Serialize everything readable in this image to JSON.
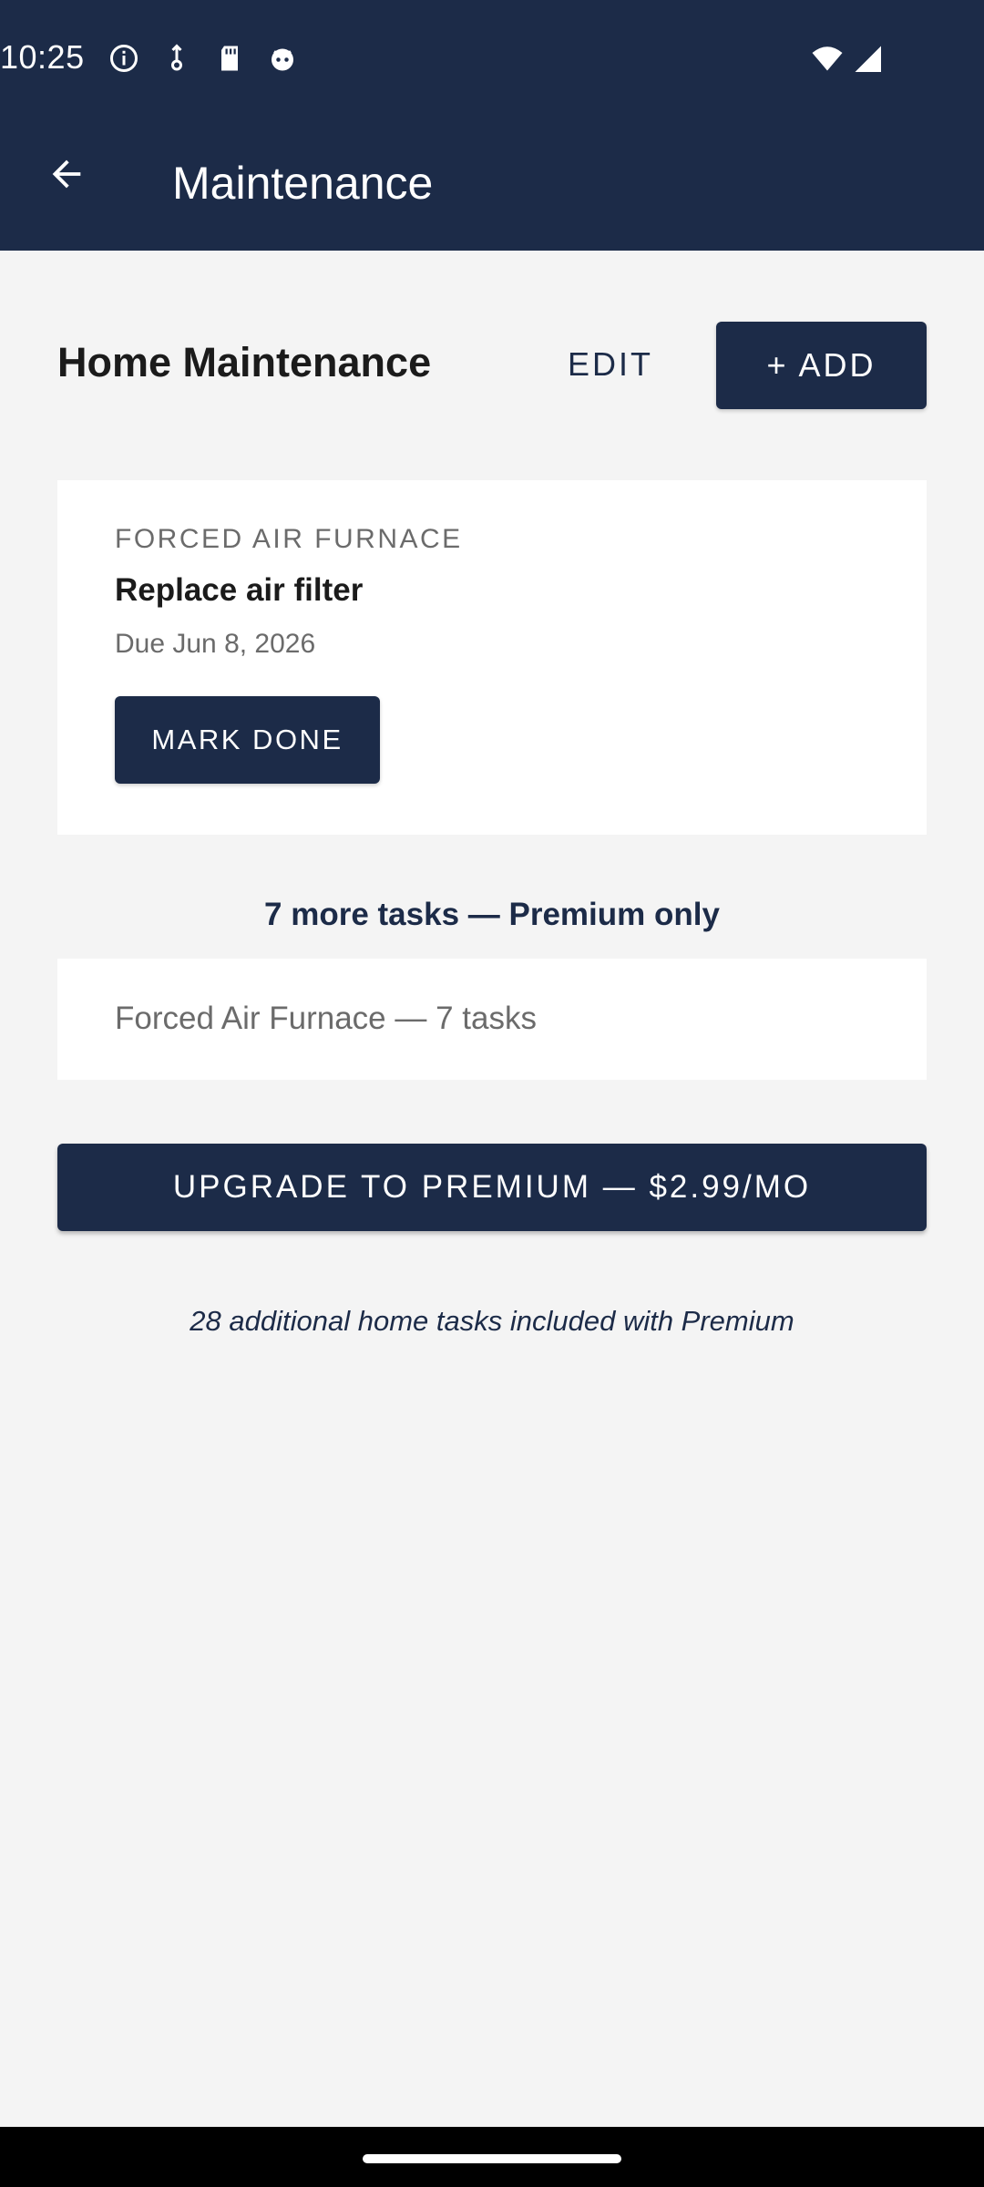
{
  "status_bar": {
    "time": "10:25",
    "icons": [
      "info-circle-icon",
      "usb-debug-icon",
      "sd-card-icon",
      "notification-face-icon",
      "wifi-icon",
      "cell-signal-icon"
    ]
  },
  "app_bar": {
    "title": "Maintenance",
    "back_icon": "arrow-back-icon"
  },
  "header": {
    "title": "Home Maintenance",
    "edit_label": "EDIT",
    "add_label": "+ ADD"
  },
  "task": {
    "category": "FORCED AIR FURNACE",
    "name": "Replace air filter",
    "due": "Due Jun 8, 2026",
    "mark_done_label": "MARK DONE"
  },
  "premium": {
    "heading": "7 more tasks — Premium only",
    "locked_group": "Forced Air Furnace — 7 tasks",
    "upgrade_label": "UPGRADE TO PREMIUM — $2.99/MO",
    "note": "28 additional home tasks included with Premium"
  },
  "colors": {
    "primary": "#1c2b48",
    "background": "#f4f4f4",
    "card": "#ffffff",
    "muted_text": "#6b6b6b"
  }
}
